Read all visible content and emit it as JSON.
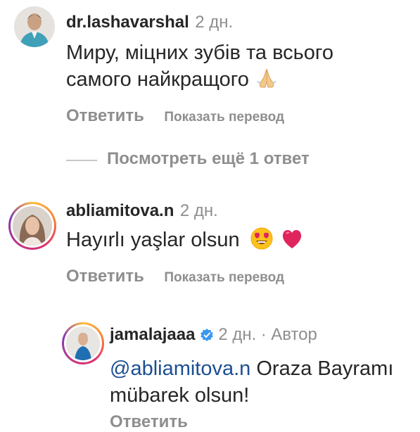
{
  "comments": [
    {
      "username": "dr.lashavarshal",
      "time": "2 дн.",
      "text": "Миру, міцних зубів та всього самого найкращого",
      "emoji": "folded-hands",
      "reply_label": "Ответить",
      "translate_label": "Показать перевод"
    },
    {
      "username": "abliamitova.n",
      "time": "2 дн.",
      "text": "Hayırlı yaşlar olsun",
      "emoji": [
        "heart-eyes",
        "red-heart"
      ],
      "reply_label": "Ответить",
      "translate_label": "Показать перевод"
    }
  ],
  "view_more_replies": "Посмотреть ещё 1 ответ",
  "reply": {
    "username": "jamalajaaa",
    "verified": true,
    "time": "2 дн.",
    "separator": "·",
    "author_label": "Автор",
    "mention": "@abliamitova.n",
    "text": "Oraza Bayramı mübarek olsun!",
    "reply_label": "Ответить"
  },
  "colors": {
    "text": "#262626",
    "secondary": "#8e8e8e",
    "mention": "#1c4f92",
    "verified": "#3897f0",
    "heart": "#e0245e"
  }
}
